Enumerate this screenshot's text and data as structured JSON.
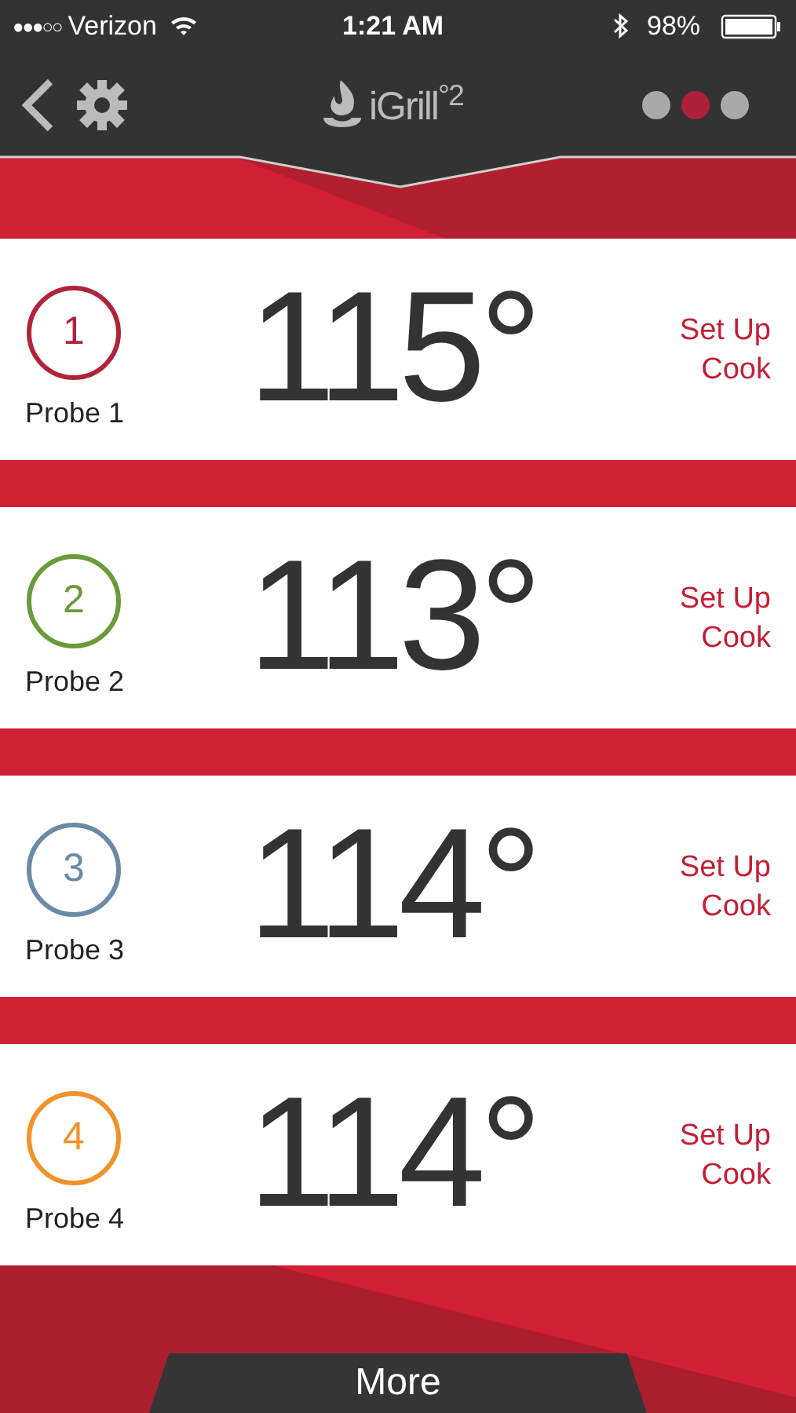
{
  "status_bar": {
    "signal": "●●●○○",
    "carrier": "Verizon",
    "time": "1:21 AM",
    "battery": "98%"
  },
  "header": {
    "logo": "iGrill$^{°2}$",
    "pages": [
      {
        "selected": false
      },
      {
        "selected": true
      },
      {
        "selected": false
      }
    ]
  },
  "probes": [
    {
      "number": "1",
      "name": "Probe 1",
      "temperature": "115°",
      "action_1": "Set Up",
      "action_2": "Cook",
      "color": "#b0243a"
    },
    {
      "number": "2",
      "name": "Probe 2",
      "temperature": "113°",
      "action_1": "Set Up",
      "action_2": "Cook",
      "color": "#6a9a3c"
    },
    {
      "number": "3",
      "name": "Probe 3",
      "temperature": "114°",
      "action_1": "Set Up",
      "action_2": "Cook",
      "color": "#6a8aa6"
    },
    {
      "number": "4",
      "name": "Probe 4",
      "temperature": "114°",
      "action_1": "Set Up",
      "action_2": "Cook",
      "color": "#f0922a"
    }
  ],
  "more_button": "More"
}
